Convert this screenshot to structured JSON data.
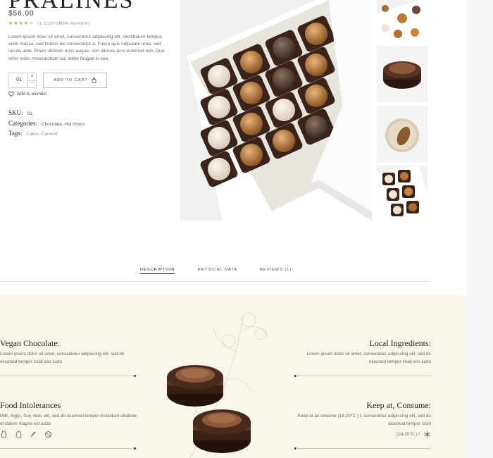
{
  "product": {
    "title": "PRALINES",
    "price": "$56.00",
    "rating": 4,
    "rating_max": 5,
    "review_count": "(1 CUSTOMER REVIEW)",
    "description": "Lorem ipsum dolor sit amet, consectetur adipiscing elit. Vestibulum tempus enim massa, sed finibus leo consectetur a. Fusce quis vulputate urna, sed iaculis ante. Etiam ultricies nunc augue, non ultrices arcu euismod non. Duo error nobis mnesarchum ad, latine feugait in sea.",
    "quantity": "01",
    "qty_plus": "+",
    "qty_minus": "−",
    "add_to_cart": "ADD TO CART",
    "wishlist": "Add to wishlist",
    "meta": {
      "sku_label": "SKU:",
      "sku_value": "01",
      "categories_label": "Categories:",
      "categories_value": "Chocolate, Hot choco",
      "tags_label": "Tags:",
      "tags_value": "Cakes, Cannoli"
    },
    "colors": {
      "accent": "#c69a5b",
      "feature_bg": "#faf6ec",
      "chocolate": "#4a2a1a"
    }
  },
  "gallery": {
    "main_image": "pralines-box-image",
    "thumbnails": [
      "pralines-box-thumb",
      "chocolate-almond-thumb",
      "white-praline-thumb",
      "box-closeup-thumb"
    ]
  },
  "tabs": [
    {
      "label": "DESCRIPTION",
      "active": true
    },
    {
      "label": "PHYSICAL DATA",
      "active": false
    },
    {
      "label": "REVIEWS (1)",
      "active": false
    }
  ],
  "features": {
    "vegan": {
      "title": "Vegan Chocolate:",
      "text": "Lorem ipsum dolor sit amet, consectetur adipiscing elit, sed do eiusmod tempor incid eos iusto"
    },
    "local": {
      "title": "Local Ingredients:",
      "text": "Lorem ipsum dolor sit amet, consectetur adipiscing elit, sed do eiusmod tempor incid eos iusto"
    },
    "intolerances": {
      "title": "Food Intolerances",
      "text": "Milk, Eggs, Soy, Nuts elit, sed do eiusmod tempor incididunt utlabore et dolore magna est iusto",
      "icons": [
        "milk-icon",
        "egg-icon",
        "grain-icon",
        "nut-icon"
      ]
    },
    "keep": {
      "title": "Keep at, Consume:",
      "text": "Keep at an cosume (18-20°C ) t, consectetur adipiscing elit, sed do eiusmod tempor incid",
      "temp": "(18-20°C ) t"
    }
  }
}
